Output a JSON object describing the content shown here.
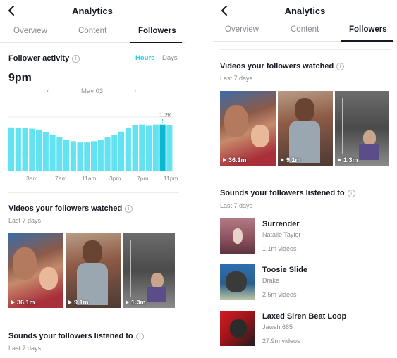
{
  "colors": {
    "accent": "#20d5ec",
    "bar": "#63e2f2",
    "bar_selected": "#0bb8cd"
  },
  "left": {
    "header": {
      "title": "Analytics"
    },
    "tabs": [
      {
        "label": "Overview"
      },
      {
        "label": "Content"
      },
      {
        "label": "Followers"
      }
    ],
    "follower_activity": {
      "title": "Follower activity",
      "toggle": {
        "hours": "Hours",
        "days": "Days"
      },
      "selected_time": "9pm",
      "date": "May 03",
      "peak_label": "1.2k",
      "x_ticks": [
        "3am",
        "7am",
        "11am",
        "3pm",
        "7pm",
        "11pm"
      ]
    },
    "videos": {
      "title": "Videos your followers watched",
      "subtitle": "Last 7 days",
      "items": [
        {
          "count": "36.1m"
        },
        {
          "count": "9.1m"
        },
        {
          "count": "1.3m"
        }
      ]
    },
    "sounds": {
      "title": "Sounds your followers listened to",
      "subtitle": "Last 7 days"
    }
  },
  "right": {
    "header": {
      "title": "Analytics"
    },
    "tabs": [
      {
        "label": "Overview"
      },
      {
        "label": "Content"
      },
      {
        "label": "Followers"
      }
    ],
    "videos": {
      "title": "Videos your followers watched",
      "subtitle": "Last 7 days",
      "items": [
        {
          "count": "36.1m"
        },
        {
          "count": "9.1m"
        },
        {
          "count": "1.3m"
        }
      ]
    },
    "sounds": {
      "title": "Sounds your followers listened to",
      "subtitle": "Last 7 days",
      "items": [
        {
          "name": "Surrender",
          "artist": "Natalie Taylor",
          "count": "1.1m videos"
        },
        {
          "name": "Toosie Slide",
          "artist": "Drake",
          "count": "2.5m videos"
        },
        {
          "name": "Laxed Siren Beat Loop",
          "artist": "Jawsh 685",
          "count": "27.9m videos"
        }
      ]
    }
  },
  "chart_data": {
    "type": "bar",
    "categories": [
      "12am",
      "1am",
      "2am",
      "3am",
      "4am",
      "5am",
      "6am",
      "7am",
      "8am",
      "9am",
      "10am",
      "11am",
      "12pm",
      "1pm",
      "2pm",
      "3pm",
      "4pm",
      "5pm",
      "6pm",
      "7pm",
      "8pm",
      "9pm",
      "10pm",
      "11pm"
    ],
    "values": [
      1.05,
      1.04,
      1.03,
      1.02,
      1.0,
      0.94,
      0.88,
      0.81,
      0.76,
      0.72,
      0.69,
      0.69,
      0.72,
      0.75,
      0.81,
      0.87,
      0.95,
      1.03,
      1.1,
      1.12,
      1.09,
      1.12,
      1.12,
      1.1
    ],
    "unit": "k",
    "selected_index": 22,
    "selected_label": "1.2k",
    "ylim": [
      0,
      1.3
    ],
    "grid": true
  }
}
